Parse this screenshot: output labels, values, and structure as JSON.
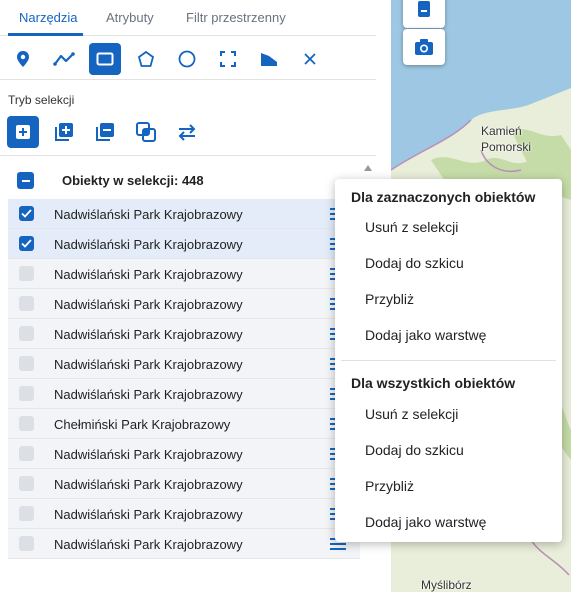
{
  "tabs": [
    {
      "label": "Narzędzia",
      "active": true
    },
    {
      "label": "Atrybuty",
      "active": false
    },
    {
      "label": "Filtr przestrzenny",
      "active": false
    }
  ],
  "tools": [
    {
      "icon": "point-icon",
      "selected": false
    },
    {
      "icon": "polyline-icon",
      "selected": false
    },
    {
      "icon": "rectangle-icon",
      "selected": true
    },
    {
      "icon": "polygon-icon",
      "selected": false
    },
    {
      "icon": "circle-icon",
      "selected": false
    },
    {
      "icon": "extent-icon",
      "selected": false
    },
    {
      "icon": "freehand-polygon-icon",
      "selected": false
    },
    {
      "icon": "clear-icon",
      "selected": false
    }
  ],
  "selection_mode": {
    "title": "Tryb selekcji",
    "modes": [
      {
        "icon": "new-selection-icon",
        "selected": true
      },
      {
        "icon": "add-to-selection-icon",
        "selected": false
      },
      {
        "icon": "remove-from-selection-icon",
        "selected": false
      },
      {
        "icon": "intersect-selection-icon",
        "selected": false
      },
      {
        "icon": "swap-selection-icon",
        "selected": false
      }
    ]
  },
  "list": {
    "header": "Obiekty w selekcji: 448",
    "rows": [
      {
        "label": "Nadwiślański Park Krajobrazowy",
        "checked": true
      },
      {
        "label": "Nadwiślański Park Krajobrazowy",
        "checked": true
      },
      {
        "label": "Nadwiślański Park Krajobrazowy",
        "checked": false
      },
      {
        "label": "Nadwiślański Park Krajobrazowy",
        "checked": false
      },
      {
        "label": "Nadwiślański Park Krajobrazowy",
        "checked": false
      },
      {
        "label": "Nadwiślański Park Krajobrazowy",
        "checked": false
      },
      {
        "label": "Nadwiślański Park Krajobrazowy",
        "checked": false
      },
      {
        "label": "Chełmiński Park Krajobrazowy",
        "checked": false
      },
      {
        "label": "Nadwiślański Park Krajobrazowy",
        "checked": false
      },
      {
        "label": "Nadwiślański Park Krajobrazowy",
        "checked": false
      },
      {
        "label": "Nadwiślański Park Krajobrazowy",
        "checked": false
      },
      {
        "label": "Nadwiślański Park Krajobrazowy",
        "checked": false
      }
    ]
  },
  "context_menu": {
    "section_selected": {
      "title": "Dla zaznaczonych obiektów",
      "items": [
        "Usuń z selekcji",
        "Dodaj do szkicu",
        "Przybliż",
        "Dodaj jako warstwę"
      ]
    },
    "section_all": {
      "title": "Dla wszystkich obiektów",
      "items": [
        "Usuń z selekcji",
        "Dodaj do szkicu",
        "Przybliż",
        "Dodaj jako warstwę"
      ]
    }
  },
  "map": {
    "labels": {
      "kamien_pomorski": "Kamień\nPomorski",
      "mysliborz": "Myślibórz"
    },
    "buttons": [
      {
        "icon": "map-tool-icon"
      },
      {
        "icon": "camera-icon"
      }
    ]
  },
  "colors": {
    "accent": "#1565c0",
    "sea": "#9dc7e3",
    "land": "#e8eed9",
    "forest": "#c6dca8"
  }
}
